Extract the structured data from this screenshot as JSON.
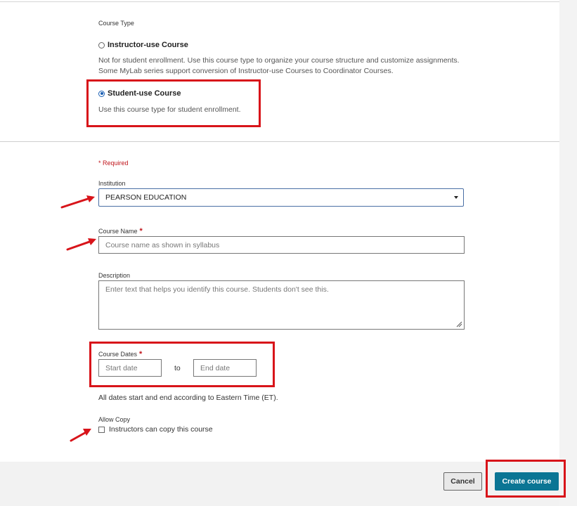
{
  "course_type": {
    "heading": "Course Type",
    "options": [
      {
        "label": "Instructor-use Course",
        "help": "Not for student enrollment. Use this course type to organize your course structure and customize assignments. Some MyLab series support conversion of Instructor-use Courses to Coordinator Courses.",
        "selected": false
      },
      {
        "label": "Student-use Course",
        "help": "Use this course type for student enrollment.",
        "selected": true
      }
    ]
  },
  "form": {
    "required_note": "* Required",
    "institution": {
      "label": "Institution",
      "value": "PEARSON EDUCATION"
    },
    "course_name": {
      "label": "Course Name",
      "required_mark": "*",
      "placeholder": "Course name as shown in syllabus"
    },
    "description": {
      "label": "Description",
      "placeholder": "Enter text that helps you identify this course. Students don't see this."
    },
    "course_dates": {
      "label": "Course Dates",
      "required_mark": "*",
      "start_placeholder": "Start date",
      "separator": "to",
      "end_placeholder": "End date",
      "note": "All dates start and end according to Eastern Time (ET)."
    },
    "allow_copy": {
      "label": "Allow Copy",
      "checkbox_label": "Instructors can copy this course",
      "checked": false
    }
  },
  "footer": {
    "cancel_label": "Cancel",
    "create_label": "Create course"
  },
  "colors": {
    "primary_button": "#0b7594",
    "annotation_red": "#d8141a",
    "required_red": "#c0161c"
  }
}
